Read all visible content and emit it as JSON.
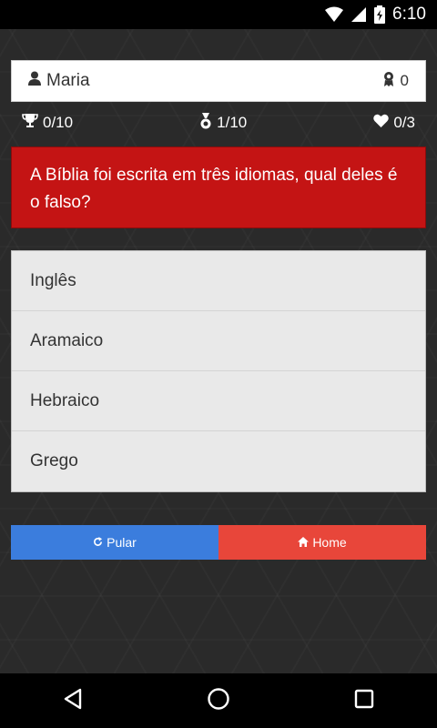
{
  "status_bar": {
    "time": "6:10"
  },
  "user": {
    "name": "Maria",
    "score": "0"
  },
  "stats": {
    "trophies": "0/10",
    "round": "1/10",
    "lives": "0/3"
  },
  "question": {
    "text": "A Bíblia foi escrita em três idiomas, qual deles é o falso?"
  },
  "answers": [
    "Inglês",
    "Aramaico",
    "Hebraico",
    "Grego"
  ],
  "actions": {
    "skip_label": "Pular",
    "home_label": "Home"
  },
  "colors": {
    "question_bg": "#c41414",
    "skip_bg": "#3b7ddd",
    "home_bg": "#e8463a"
  }
}
